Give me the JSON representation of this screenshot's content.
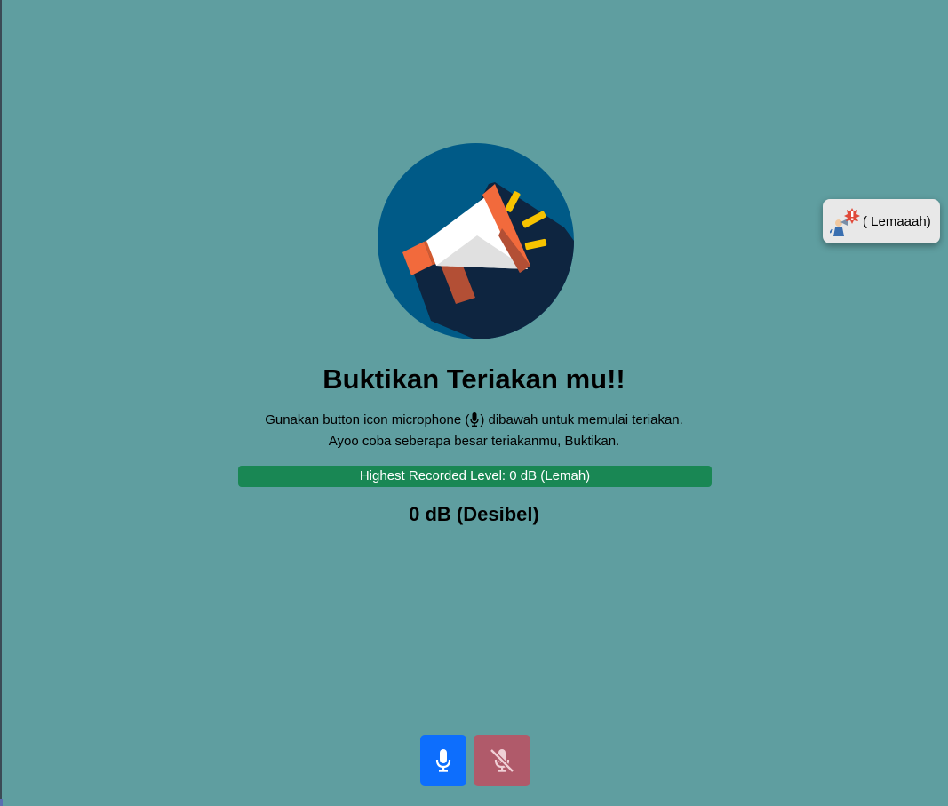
{
  "hero": {
    "logo_icon": "megaphone-icon",
    "title": "Buktikan Teriakan mu!!"
  },
  "instructions": {
    "line1_before": "Gunakan button icon microphone (",
    "line1_icon": "microphone-icon",
    "line1_after": ") dibawah untuk memulai teriakan.",
    "line2": "Ayoo coba seberapa besar teriakanmu, Buktikan."
  },
  "level_bar": {
    "text": "Highest Recorded Level: 0 dB (Lemah)",
    "color": "#198754",
    "progress_percent": 0
  },
  "readout": {
    "value_text": "0 dB (Desibel)"
  },
  "toast": {
    "icon": "shouting-warning-icon",
    "text": "( Lemaaah)"
  },
  "controls": {
    "start_icon": "microphone-icon",
    "start_color": "#0d6efd",
    "stop_icon": "microphone-slash-icon",
    "stop_color": "#b05a6a"
  },
  "colors": {
    "background": "#5f9ea0",
    "logo_circle": "#005a87",
    "logo_shadow": "#0e2540"
  }
}
